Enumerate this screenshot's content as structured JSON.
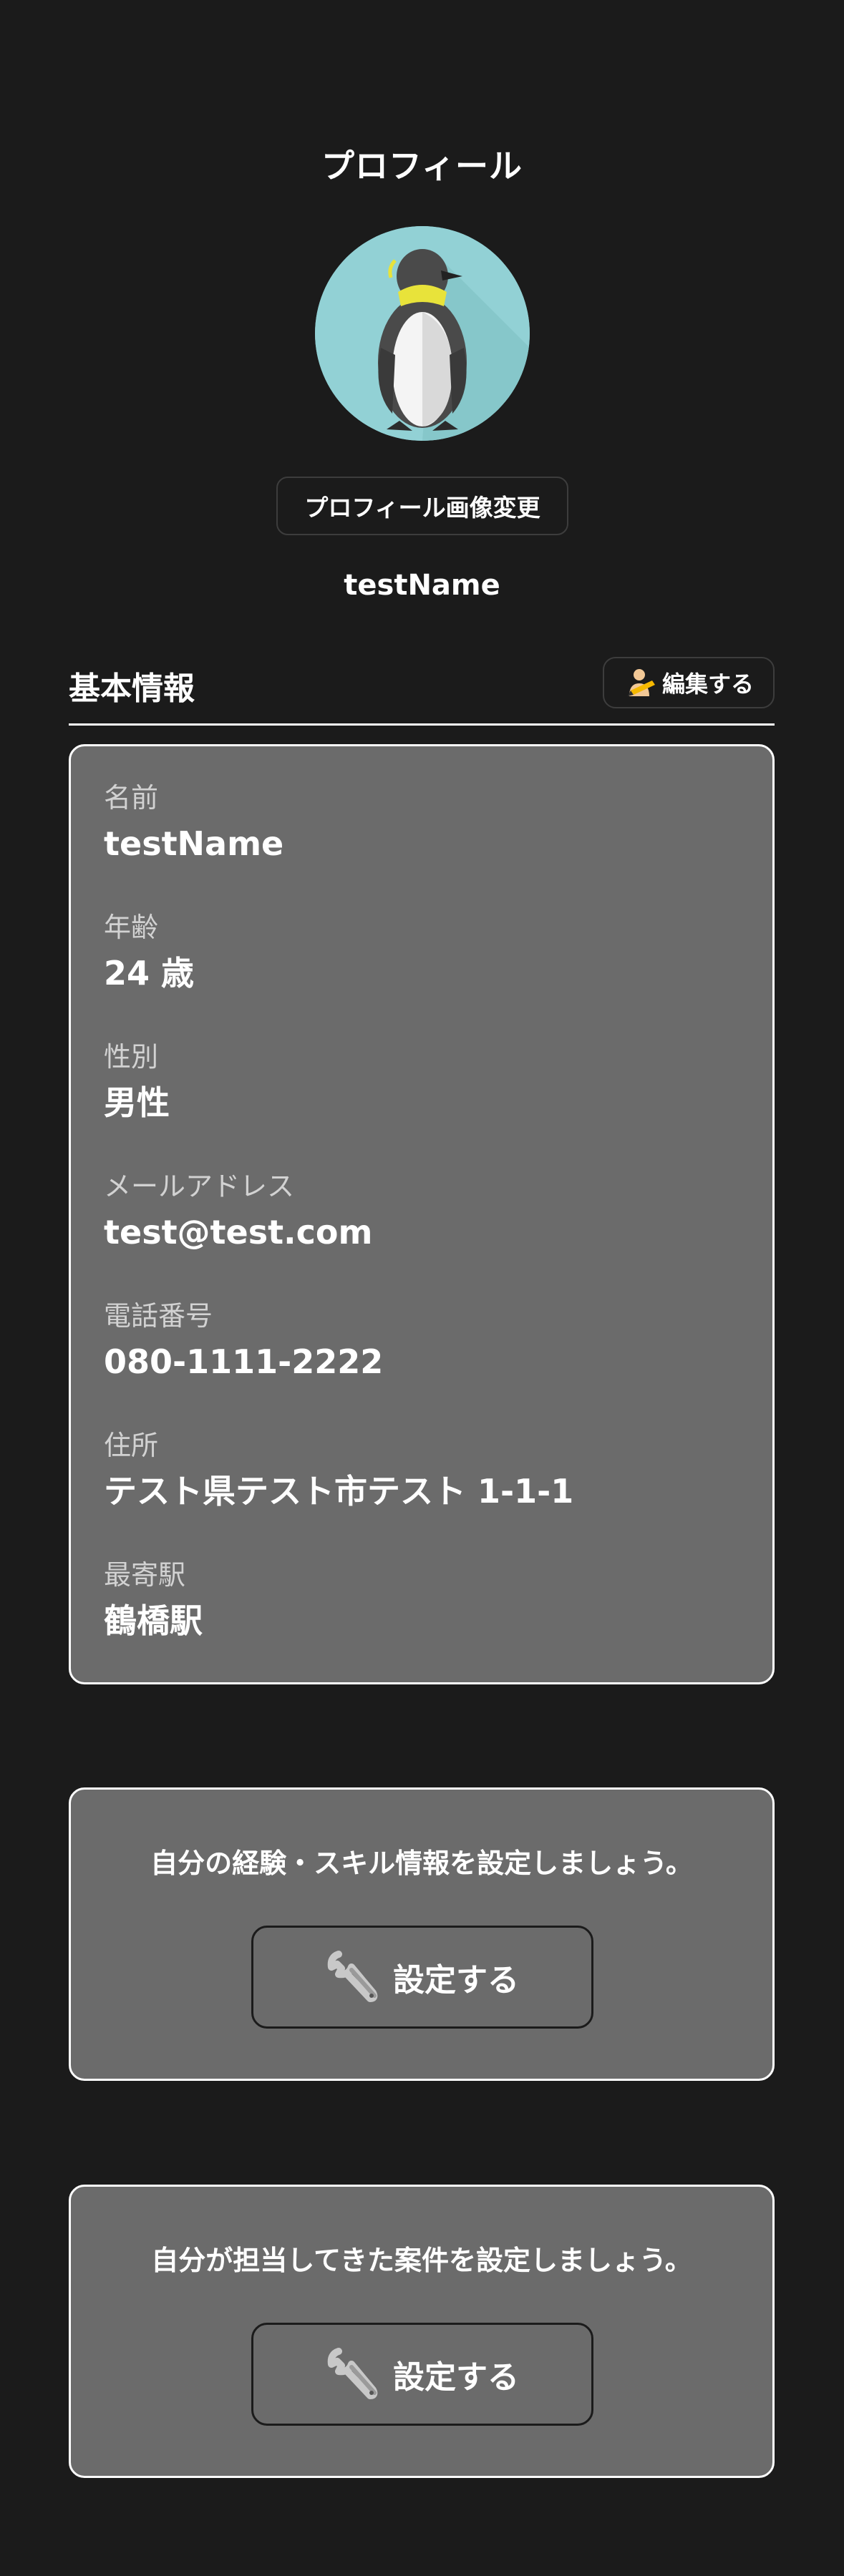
{
  "header": {
    "title": "プロフィール"
  },
  "profile": {
    "avatar_icon": "penguin-avatar",
    "change_photo_label": "プロフィール画像変更",
    "username": "testName"
  },
  "basic_info": {
    "section_title": "基本情報",
    "edit_label": "編集する",
    "edit_icon": "person-edit-icon",
    "items": [
      {
        "label": "名前",
        "value": "testName"
      },
      {
        "label": "年齢",
        "value": "24 歳"
      },
      {
        "label": "性別",
        "value": "男性"
      },
      {
        "label": "メールアドレス",
        "value": "test@test.com"
      },
      {
        "label": "電話番号",
        "value": "080-1111-2222"
      },
      {
        "label": "住所",
        "value": "テスト県テスト市テスト 1-1-1"
      },
      {
        "label": "最寄駅",
        "value": "鶴橋駅"
      }
    ]
  },
  "skills_card": {
    "message": "自分の経験・スキル情報を設定しましょう。",
    "button_label": "設定する",
    "button_icon": "wrench-icon"
  },
  "projects_card": {
    "message": "自分が担当してきた案件を設定しましょう。",
    "button_label": "設定する",
    "button_icon": "wrench-icon"
  },
  "colors": {
    "background": "#1b1b1b",
    "card": "#6b6b6b",
    "text": "#ffffff",
    "label": "#d2d2d2",
    "avatar_bg": "#92d1d5"
  }
}
